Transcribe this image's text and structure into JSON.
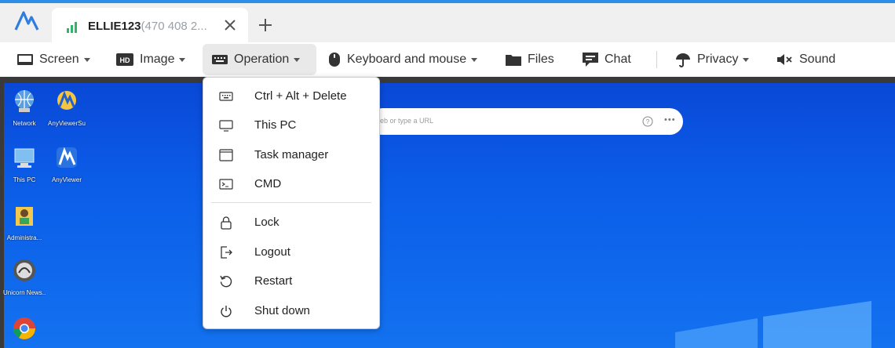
{
  "tab": {
    "title": "ELLIE123",
    "id_suffix": "(470 408 2..."
  },
  "toolbar": {
    "screen": "Screen",
    "image": "Image",
    "image_badge": "HD",
    "operation": "Operation",
    "keyboard_mouse": "Keyboard and mouse",
    "files": "Files",
    "chat": "Chat",
    "privacy": "Privacy",
    "sound": "Sound"
  },
  "operation_menu": {
    "items": [
      {
        "label": "Ctrl + Alt + Delete",
        "icon": "keyboard-icon"
      },
      {
        "label": "This PC",
        "icon": "monitor-icon"
      },
      {
        "label": "Task manager",
        "icon": "window-icon"
      },
      {
        "label": "CMD",
        "icon": "terminal-icon"
      },
      {
        "label": "Lock",
        "icon": "lock-icon"
      },
      {
        "label": "Logout",
        "icon": "logout-icon"
      },
      {
        "label": "Restart",
        "icon": "restart-icon"
      },
      {
        "label": "Shut down",
        "icon": "power-icon"
      }
    ]
  },
  "remote_desktop": {
    "search_placeholder": "eb or type a URL",
    "icons": [
      {
        "label": "Network"
      },
      {
        "label": "AnyViewerSu"
      },
      {
        "label": "This PC"
      },
      {
        "label": "AnyViewer"
      },
      {
        "label": "Administra..."
      },
      {
        "label": "Unicorn News..."
      }
    ]
  },
  "colors": {
    "accent": "#2e8ee6",
    "desktop_blue": "#0b5de8"
  }
}
